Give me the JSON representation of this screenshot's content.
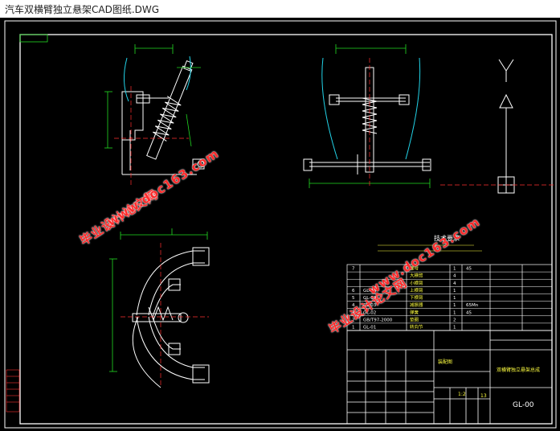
{
  "window": {
    "title": "汽车双横臂独立悬架CAD图纸.DWG"
  },
  "watermarks": {
    "site": "www.doc163.com",
    "site2": "www.doc163.com",
    "name": "毕业设计论文网",
    "name2": "毕业设计论文网"
  },
  "drawing": {
    "tech_req_title": "技术要求",
    "bom": [
      {
        "no": "7",
        "code": "",
        "name": "螺母",
        "qty": "1",
        "mat": "45"
      },
      {
        "no": "",
        "code": "",
        "name": "大横臂",
        "qty": "4",
        "mat": ""
      },
      {
        "no": "",
        "code": "",
        "name": "小横臂",
        "qty": "4",
        "mat": ""
      },
      {
        "no": "6",
        "code": "GL-05",
        "name": "上横臂",
        "qty": "1",
        "mat": ""
      },
      {
        "no": "5",
        "code": "GL-04",
        "name": "下横臂",
        "qty": "1",
        "mat": ""
      },
      {
        "no": "4",
        "code": "GL-03",
        "name": "减振器",
        "qty": "1",
        "mat": "65Mn"
      },
      {
        "no": "3",
        "code": "GL-02",
        "name": "弹簧",
        "qty": "1",
        "mat": "45"
      },
      {
        "no": "2",
        "code": "GB/T97-2000",
        "name": "垫圈",
        "qty": "2",
        "mat": ""
      },
      {
        "no": "1",
        "code": "GL-01",
        "name": "转向节",
        "qty": "1",
        "mat": ""
      }
    ],
    "title_block": {
      "title": "双横臂独立悬架总成",
      "assembly": "装配图",
      "scale": "1:2",
      "sheet": "13",
      "drawing_no": "GL-00"
    }
  },
  "colors": {
    "line": "#ffffff",
    "green": "#22dd22",
    "red": "#ff3030",
    "cyan": "#22d3e8",
    "yellow": "#ffff40"
  }
}
